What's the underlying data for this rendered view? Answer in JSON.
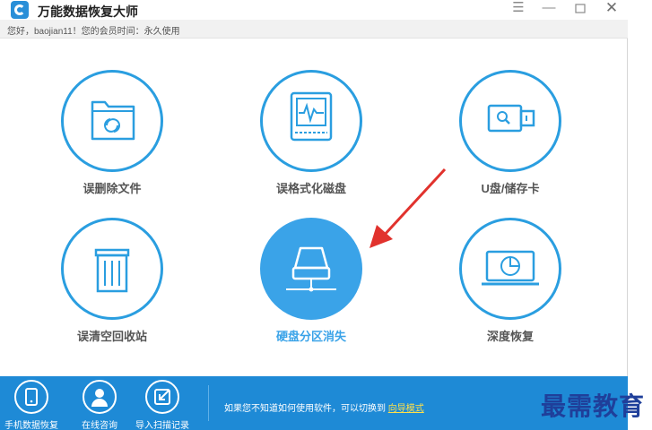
{
  "window": {
    "title": "万能数据恢复大师",
    "controls": [
      "menu-icon",
      "minimize-icon",
      "maximize-icon",
      "close-icon"
    ]
  },
  "infobar": {
    "greeting": "您好，baojian11！您的会员时间：永久使用"
  },
  "tiles": [
    {
      "label": "误删除文件",
      "icon": "folder-recycle-icon"
    },
    {
      "label": "误格式化磁盘",
      "icon": "disk-waveform-icon"
    },
    {
      "label": "U盘/储存卡",
      "icon": "usb-drive-icon"
    },
    {
      "label": "误清空回收站",
      "icon": "trash-bin-icon"
    },
    {
      "label": "硬盘分区消失",
      "icon": "hard-drive-partition-icon",
      "selected": true
    },
    {
      "label": "深度恢复",
      "icon": "monitor-scan-icon"
    }
  ],
  "bottombar": {
    "items": [
      {
        "label": "手机数据恢复",
        "icon": "phone-icon"
      },
      {
        "label": "在线咨询",
        "icon": "person-icon"
      },
      {
        "label": "导入扫描记录",
        "icon": "import-icon"
      }
    ],
    "message": "如果您不知道如何使用软件，可以切换到",
    "link": "向导模式"
  },
  "watermark": "最需教育",
  "colors": {
    "accent": "#2a9ee0",
    "selected": "#3aa3e8",
    "bottom_bar": "#1e8ad6",
    "arrow": "#e1322d",
    "link": "#ffe04a"
  }
}
